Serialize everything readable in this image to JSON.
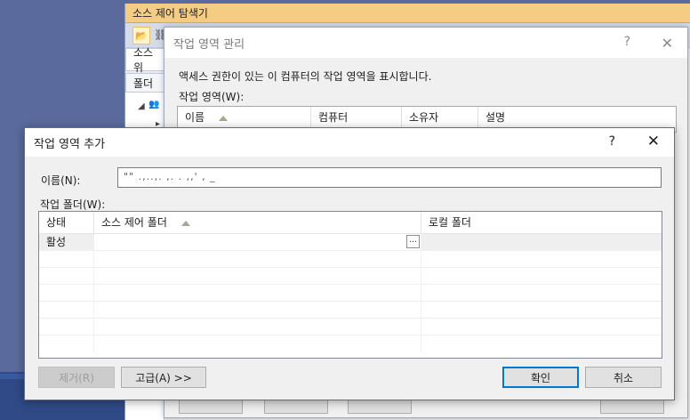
{
  "explorer": {
    "title": "소스 제어 탐색기",
    "tab_label": "소스 위",
    "folder_header": "폴더"
  },
  "manage_dialog": {
    "title": "작업 영역 관리",
    "help": "?",
    "close": "✕",
    "description": "액세스 권한이 있는 이 컴퓨터의 작업 영역을 표시합니다.",
    "list_label": "작업 영역(W):",
    "columns": [
      "이름",
      "컴퓨터",
      "소유자",
      "설명"
    ]
  },
  "add_dialog": {
    "title": "작업 영역 추가",
    "help": "?",
    "close": "✕",
    "name_label": "이름(N):",
    "name_value": "\"\"  .,..,. ,.     .  ,,'  ,    _",
    "folders_label": "작업 폴더(W):",
    "columns": {
      "status": "상태",
      "source": "소스 제어 폴더",
      "local": "로컬 폴더"
    },
    "rows": [
      {
        "status": "활성",
        "source": "",
        "local": ""
      }
    ],
    "ellipsis": "...",
    "buttons": {
      "remove": "제거(R)",
      "advanced": "고급(A) >>",
      "ok": "확인",
      "cancel": "취소"
    }
  },
  "colors": {
    "explorer_title_bg": "#f5cc84",
    "desktop_bg": "#5a6a9c",
    "accent": "#0078d7"
  }
}
